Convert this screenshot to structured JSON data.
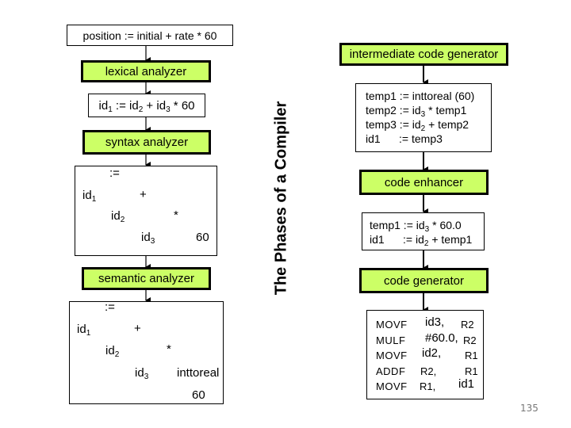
{
  "title": "The Phases of a Compiler",
  "colors": {
    "phase_fill": "#ccff66",
    "border": "#000000"
  },
  "source": {
    "text": "position := initial + rate * 60"
  },
  "phases": {
    "lexical": "lexical analyzer",
    "syntax": "syntax analyzer",
    "semantic": "semantic analyzer",
    "intermediate": "intermediate code generator",
    "enhancer": "code enhancer",
    "generator": "code generator"
  },
  "tokens": {
    "id": "id",
    "s1": "1",
    "s2": "2",
    "s3": "3",
    "assign": " := ",
    "plus": " + ",
    "star": " * ",
    "num": "60"
  },
  "syntax_tree": {
    "root": ":=",
    "id1": "id",
    "plus": "+",
    "id2": "id",
    "star": "*",
    "id3": "id",
    "num": "60"
  },
  "semantic_tree": {
    "root": ":=",
    "id1": "id",
    "plus": "+",
    "id2": "id",
    "star": "*",
    "id3": "id",
    "conv": "inttoreal",
    "num": "60"
  },
  "intermediate_code": [
    {
      "lhs": "temp1 := inttoreal (60)"
    },
    {
      "lhs": "temp2 := id",
      "sub": "3",
      "rhs": " * temp1"
    },
    {
      "lhs": "temp3 := id",
      "sub": "2",
      "rhs": " + temp2"
    },
    {
      "lhs": "id1      := temp3"
    }
  ],
  "optimized_code": [
    {
      "lhs": "temp1 := id",
      "sub": "3",
      "rhs": " * 60.0"
    },
    {
      "lhs": "id1      := id",
      "sub": "2",
      "rhs": " + temp1"
    }
  ],
  "target_code": [
    {
      "op": "MOVF",
      "a1": "id3,",
      "a2": "R2"
    },
    {
      "op": "MULF",
      "a1": "#60.0,",
      "a2": "R2"
    },
    {
      "op": "MOVF",
      "a1": "id2,",
      "a2": "R1"
    },
    {
      "op": "ADDF",
      "a1": "R2,",
      "a2": "R1"
    },
    {
      "op": "MOVF",
      "a1": "R1,",
      "a2": "id1"
    }
  ],
  "page_number": "135"
}
